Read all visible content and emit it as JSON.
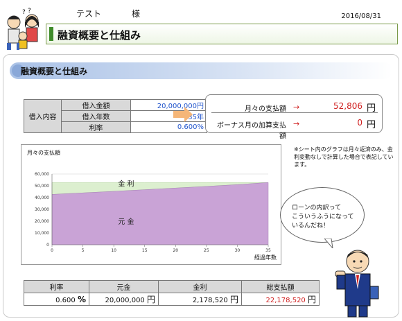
{
  "header": {
    "user_name": "テスト",
    "honorific": "様",
    "date": "2016/08/31",
    "page_title": "融資概要と仕組み"
  },
  "section": {
    "title": "融資概要と仕組み"
  },
  "loan_info": {
    "group_label": "借入内容",
    "rows": [
      {
        "label": "借入金額",
        "value": "20,000,000",
        "unit": "円"
      },
      {
        "label": "借入年数",
        "value": "35",
        "unit": "年"
      },
      {
        "label": "利率",
        "value": "0.600",
        "unit": "%"
      }
    ]
  },
  "results": {
    "monthly_label": "月々の支払額",
    "monthly_value": "52,806",
    "bonus_label": "ボーナス月の加算支払額",
    "bonus_value": "0",
    "unit": "円",
    "arrow": "→"
  },
  "note": {
    "text": "※シート内のグラフは月々返済のみ、金利変動なしで計算した場合で表記しています。"
  },
  "bubble": {
    "lines": [
      "ローンの内訳って",
      "こういうふうになって",
      "いるんだね！"
    ]
  },
  "chart_data": {
    "type": "area",
    "title": "月々の支払額",
    "xlabel": "経過年数",
    "ylabel": "",
    "x": [
      0,
      5,
      10,
      15,
      20,
      25,
      30,
      35
    ],
    "xlim": [
      0,
      35
    ],
    "ylim": [
      0,
      60000
    ],
    "yticks": [
      "0",
      "10,000",
      "20,000",
      "30,000",
      "40,000",
      "50,000",
      "60,000"
    ],
    "xticks": [
      "0",
      "5",
      "10",
      "15",
      "20",
      "25",
      "30",
      "35"
    ],
    "series": [
      {
        "name": "元金",
        "values": [
          42700,
          44000,
          45300,
          46700,
          48100,
          49500,
          51000,
          52806
        ],
        "color": "#c9a3d6"
      },
      {
        "name": "金利",
        "values": [
          10106,
          8806,
          7506,
          6106,
          4706,
          3306,
          1806,
          0
        ],
        "color": "#dcefcf"
      }
    ],
    "area_labels": [
      "金 利",
      "元 金"
    ]
  },
  "summary": {
    "headers": [
      "利率",
      "元金",
      "金利",
      "総支払額"
    ],
    "values": [
      {
        "value": "0.600",
        "unit": "%"
      },
      {
        "value": "20,000,000",
        "unit": "円"
      },
      {
        "value": "2,178,520",
        "unit": "円"
      },
      {
        "value": "22,178,520",
        "unit": "円"
      }
    ]
  }
}
